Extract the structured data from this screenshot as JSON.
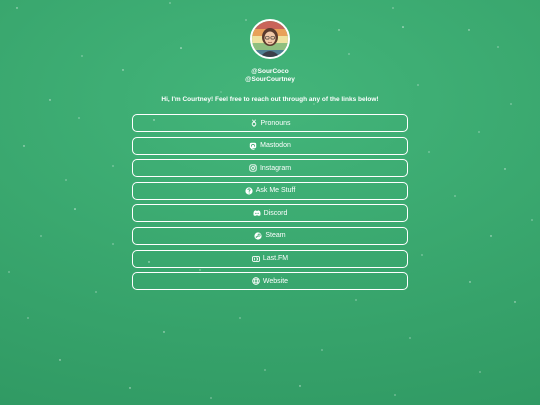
{
  "profile": {
    "handle_primary": "@SourCoco",
    "handle_secondary": "@SourCourtney",
    "bio": "Hi, I'm Courtney! Feel free to reach out through any of the links below!"
  },
  "links": [
    {
      "label": "Pronouns",
      "icon": "gender-icon"
    },
    {
      "label": "Mastodon",
      "icon": "mastodon-icon"
    },
    {
      "label": "Instagram",
      "icon": "instagram-icon"
    },
    {
      "label": "Ask Me Stuff",
      "icon": "question-icon"
    },
    {
      "label": "Discord",
      "icon": "discord-icon"
    },
    {
      "label": "Steam",
      "icon": "steam-icon"
    },
    {
      "label": "Last.FM",
      "icon": "lastfm-icon"
    },
    {
      "label": "Website",
      "icon": "globe-icon"
    }
  ],
  "colors": {
    "background": "#3aa86f",
    "button_border": "#ffffff",
    "text": "#ffffff"
  }
}
